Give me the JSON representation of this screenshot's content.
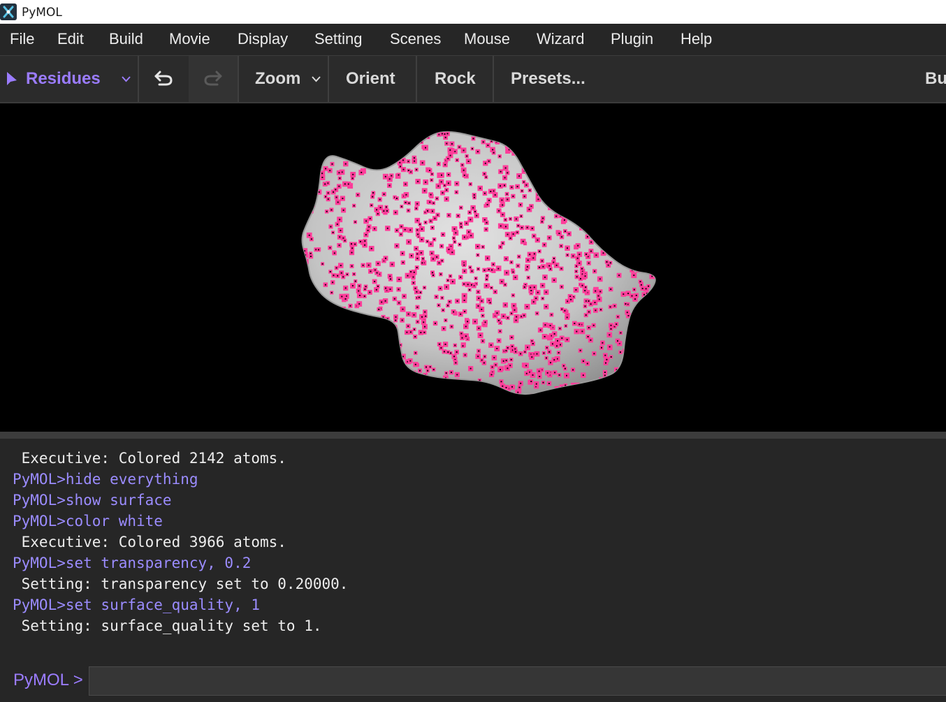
{
  "window": {
    "title": "PyMOL"
  },
  "menu": [
    "File",
    "Edit",
    "Build",
    "Movie",
    "Display",
    "Setting",
    "Scenes",
    "Mouse",
    "Wizard",
    "Plugin",
    "Help"
  ],
  "toolbar": {
    "mode_label": "Residues",
    "zoom_label": "Zoom",
    "orient_label": "Orient",
    "rock_label": "Rock",
    "presets_label": "Presets...",
    "builder_label": "Bu"
  },
  "console": {
    "lines": [
      {
        "type": "out",
        "text": " Executive: Colored 2142 atoms."
      },
      {
        "type": "cmd",
        "text": "PyMOL>hide everything"
      },
      {
        "type": "cmd",
        "text": "PyMOL>show surface"
      },
      {
        "type": "cmd",
        "text": "PyMOL>color white"
      },
      {
        "type": "out",
        "text": " Executive: Colored 3966 atoms."
      },
      {
        "type": "cmd",
        "text": "PyMOL>set transparency, 0.2"
      },
      {
        "type": "out",
        "text": " Setting: transparency set to 0.20000."
      },
      {
        "type": "cmd",
        "text": "PyMOL>set surface_quality, 1"
      },
      {
        "type": "out",
        "text": " Setting: surface_quality set to 1."
      }
    ]
  },
  "prompt": {
    "label": "PyMOL >",
    "value": ""
  },
  "colors": {
    "accent": "#9b7cff",
    "command": "#9b8cff",
    "surface_dots": "#ff3d9a",
    "surface": "#d8d8d8"
  },
  "icons": {
    "mode": "cursor-arrow-icon",
    "undo": "undo-icon",
    "redo": "redo-icon"
  }
}
